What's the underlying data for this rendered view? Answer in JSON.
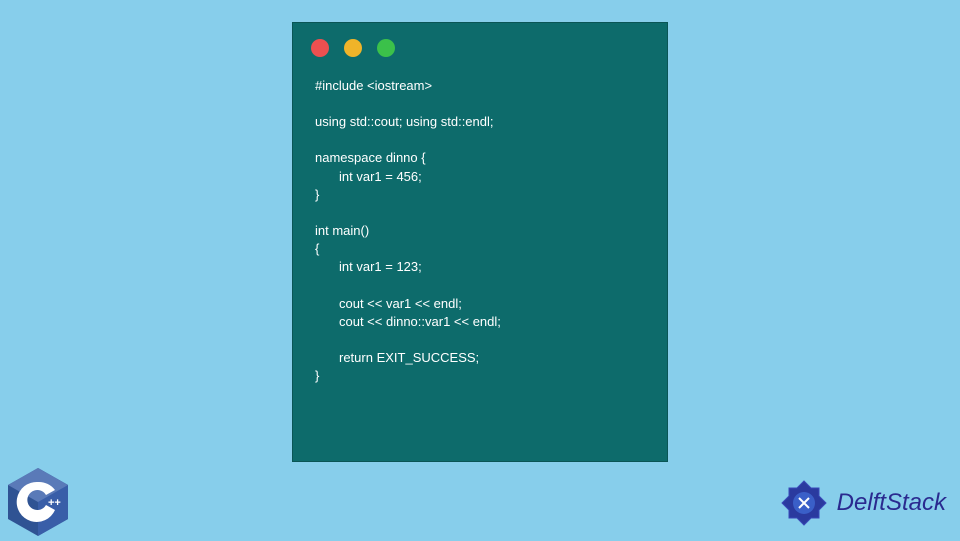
{
  "code": {
    "lines": [
      {
        "text": "#include <iostream>",
        "indent": false
      },
      {
        "text": "",
        "blank": true
      },
      {
        "text": "using std::cout; using std::endl;",
        "indent": false
      },
      {
        "text": "",
        "blank": true
      },
      {
        "text": "namespace dinno {",
        "indent": false
      },
      {
        "text": "int var1 = 456;",
        "indent": true
      },
      {
        "text": "}",
        "indent": false
      },
      {
        "text": "",
        "blank": true
      },
      {
        "text": "int main()",
        "indent": false
      },
      {
        "text": "{",
        "indent": false
      },
      {
        "text": "int var1 = 123;",
        "indent": true
      },
      {
        "text": "",
        "blank": true
      },
      {
        "text": "cout << var1 << endl;",
        "indent": true
      },
      {
        "text": "cout << dinno::var1 << endl;",
        "indent": true
      },
      {
        "text": "",
        "blank": true
      },
      {
        "text": "return EXIT_SUCCESS;",
        "indent": true
      },
      {
        "text": "}",
        "indent": false
      }
    ]
  },
  "badges": {
    "cpp_label": "C++",
    "brand_name": "DelftStack"
  },
  "colors": {
    "page_bg": "#87ceeb",
    "window_bg": "#0d6b6b",
    "traffic_red": "#ec5050",
    "traffic_yellow": "#f0b429",
    "traffic_green": "#3bc14a",
    "cpp_blue": "#395ea8",
    "brand_blue": "#2a2a8f"
  }
}
